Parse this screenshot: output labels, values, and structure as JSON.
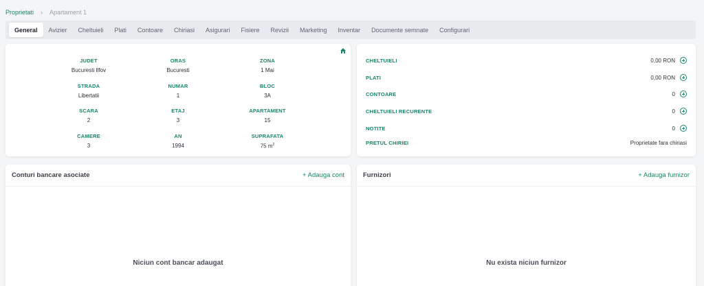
{
  "breadcrumb": {
    "parent": "Proprietati",
    "separator": "›",
    "current": "Apartament 1"
  },
  "tabs": [
    {
      "label": "General",
      "active": true
    },
    {
      "label": "Avizier"
    },
    {
      "label": "Cheltuieli"
    },
    {
      "label": "Plati"
    },
    {
      "label": "Contoare"
    },
    {
      "label": "Chiriasi"
    },
    {
      "label": "Asigurari"
    },
    {
      "label": "Fisiere"
    },
    {
      "label": "Revizii"
    },
    {
      "label": "Marketing"
    },
    {
      "label": "Inventar"
    },
    {
      "label": "Documente semnate"
    },
    {
      "label": "Configurari"
    }
  ],
  "details": {
    "icon": "home-edit-icon",
    "fields": [
      {
        "label": "JUDET",
        "value": "Bucuresti Ilfov"
      },
      {
        "label": "ORAS",
        "value": "Bucuresti"
      },
      {
        "label": "ZONA",
        "value": "1 Mai"
      },
      {
        "label": "STRADA",
        "value": "Libertatii"
      },
      {
        "label": "NUMAR",
        "value": "1"
      },
      {
        "label": "BLOC",
        "value": "3A"
      },
      {
        "label": "SCARA",
        "value": "2"
      },
      {
        "label": "ETAJ",
        "value": "3"
      },
      {
        "label": "APARTAMENT",
        "value": "15"
      },
      {
        "label": "CAMERE",
        "value": "3"
      },
      {
        "label": "AN",
        "value": "1994"
      },
      {
        "label": "SUPRAFATA",
        "value": "75 m",
        "unit_sup": "2"
      }
    ]
  },
  "summary": {
    "rows": [
      {
        "label": "CHELTUIELI",
        "value": "0,00 RON",
        "addable": true
      },
      {
        "label": "PLATI",
        "value": "0,00 RON",
        "addable": true
      },
      {
        "label": "CONTOARE",
        "value": "0",
        "addable": true
      },
      {
        "label": "CHELTUIELI RECURENTE",
        "value": "0",
        "addable": true
      },
      {
        "label": "NOTITE",
        "value": "0",
        "addable": true
      },
      {
        "label": "PRETUL CHIRIEI",
        "value": "Proprietate fara chiriasi",
        "addable": false
      }
    ]
  },
  "bank_accounts": {
    "title": "Conturi bancare asociate",
    "add_label": "+ Adauga cont",
    "empty_message": "Niciun cont bancar adaugat"
  },
  "suppliers": {
    "title": "Furnizori",
    "add_label": "+ Adauga furnizor",
    "empty_message": "Nu exista niciun furnizor"
  },
  "colors": {
    "accent": "#16856a",
    "background": "#f4f5f7",
    "card": "#ffffff"
  }
}
